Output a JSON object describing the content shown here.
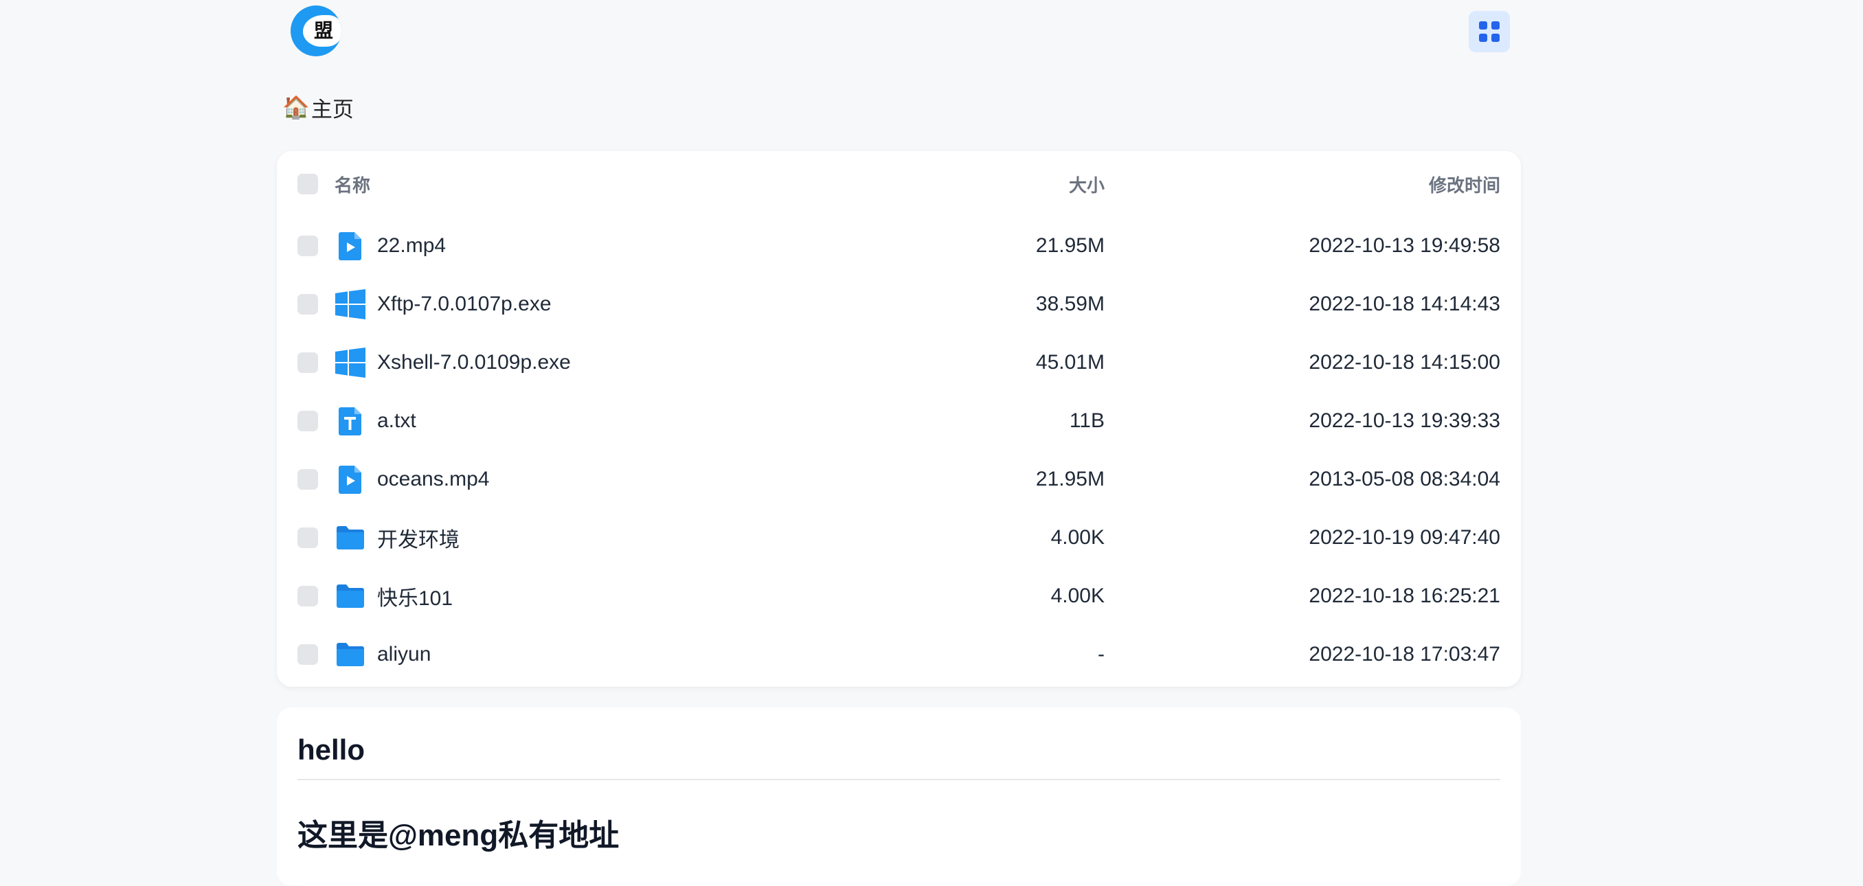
{
  "header": {
    "logo_text": "盟"
  },
  "breadcrumb": {
    "home_icon": "🏠",
    "label": "主页"
  },
  "table": {
    "headers": {
      "name": "名称",
      "size": "大小",
      "modified": "修改时间"
    },
    "rows": [
      {
        "name": "22.mp4",
        "size": "21.95M",
        "modified": "2022-10-13 19:49:58",
        "icon": "video-file-icon"
      },
      {
        "name": "Xftp-7.0.0107p.exe",
        "size": "38.59M",
        "modified": "2022-10-18 14:14:43",
        "icon": "windows-exe-icon"
      },
      {
        "name": "Xshell-7.0.0109p.exe",
        "size": "45.01M",
        "modified": "2022-10-18 14:15:00",
        "icon": "windows-exe-icon"
      },
      {
        "name": "a.txt",
        "size": "11B",
        "modified": "2022-10-13 19:39:33",
        "icon": "text-file-icon"
      },
      {
        "name": "oceans.mp4",
        "size": "21.95M",
        "modified": "2013-05-08 08:34:04",
        "icon": "video-file-icon"
      },
      {
        "name": "开发环境",
        "size": "4.00K",
        "modified": "2022-10-19 09:47:40",
        "icon": "folder-icon"
      },
      {
        "name": "快乐101",
        "size": "4.00K",
        "modified": "2022-10-18 16:25:21",
        "icon": "folder-icon"
      },
      {
        "name": "aliyun",
        "size": "-",
        "modified": "2022-10-18 17:03:47",
        "icon": "folder-icon"
      }
    ]
  },
  "readme": {
    "heading": "hello",
    "subheading": "这里是@meng私有地址"
  },
  "colors": {
    "accent": "#2196f3",
    "background": "#f7f8fa",
    "panel": "#ffffff"
  }
}
